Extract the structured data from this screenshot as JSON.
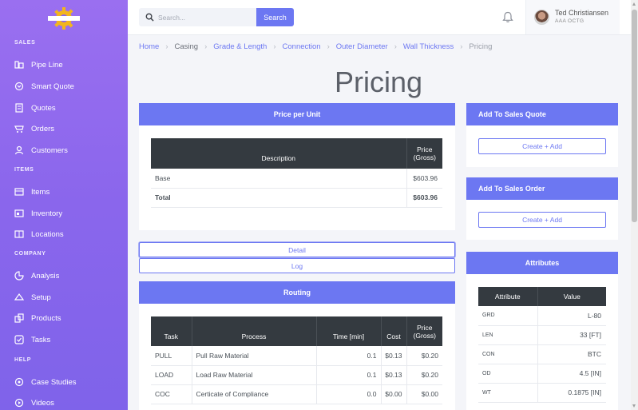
{
  "sidebar": {
    "sections": [
      {
        "title": "SALES",
        "items": [
          {
            "label": "Pipe Line",
            "icon": "pipeline-icon"
          },
          {
            "label": "Smart Quote",
            "icon": "smart-quote-icon"
          },
          {
            "label": "Quotes",
            "icon": "quotes-icon"
          },
          {
            "label": "Orders",
            "icon": "orders-icon"
          },
          {
            "label": "Customers",
            "icon": "customers-icon"
          }
        ]
      },
      {
        "title": "ITEMS",
        "items": [
          {
            "label": "Items",
            "icon": "items-icon"
          },
          {
            "label": "Inventory",
            "icon": "inventory-icon"
          },
          {
            "label": "Locations",
            "icon": "locations-icon"
          }
        ]
      },
      {
        "title": "COMPANY",
        "items": [
          {
            "label": "Analysis",
            "icon": "analysis-icon"
          },
          {
            "label": "Setup",
            "icon": "setup-icon"
          },
          {
            "label": "Products",
            "icon": "products-icon"
          },
          {
            "label": "Tasks",
            "icon": "tasks-icon"
          }
        ]
      },
      {
        "title": "HELP",
        "items": [
          {
            "label": "Case Studies",
            "icon": "case-studies-icon"
          },
          {
            "label": "Videos",
            "icon": "videos-icon"
          }
        ]
      }
    ]
  },
  "search": {
    "placeholder": "Search...",
    "button_label": "Search"
  },
  "user": {
    "name": "Ted Christiansen",
    "org": "AAA OCTG"
  },
  "breadcrumb": [
    "Home",
    "Casing",
    "Grade & Length",
    "Connection",
    "Outer Diameter",
    "Wall Thickness",
    "Pricing"
  ],
  "page_title": "Pricing",
  "price_per_unit": {
    "title": "Price per Unit",
    "columns": [
      "Description",
      "Price (Gross)"
    ],
    "rows": [
      {
        "description": "Base",
        "price": "$603.96"
      },
      {
        "description": "Total",
        "price": "$603.96"
      }
    ]
  },
  "buttons": {
    "detail": "Detail",
    "log": "Log"
  },
  "routing": {
    "title": "Routing",
    "columns": [
      "Task",
      "Process",
      "Time [min]",
      "Cost",
      "Price (Gross)"
    ],
    "rows": [
      {
        "task": "PULL",
        "process": "Pull Raw Material",
        "time": "0.1",
        "cost": "$0.13",
        "price": "$0.20"
      },
      {
        "task": "LOAD",
        "process": "Load Raw Material",
        "time": "0.1",
        "cost": "$0.13",
        "price": "$0.20"
      },
      {
        "task": "COC",
        "process": "Certicate of Compliance",
        "time": "0.0",
        "cost": "$0.00",
        "price": "$0.00"
      }
    ]
  },
  "sales_quote": {
    "title": "Add To Sales Quote",
    "button": "Create + Add"
  },
  "sales_order": {
    "title": "Add To Sales Order",
    "button": "Create + Add"
  },
  "attributes": {
    "title": "Attributes",
    "columns": [
      "Attribute",
      "Value"
    ],
    "rows": [
      {
        "name": "GRD",
        "value": "L-80"
      },
      {
        "name": "LEN",
        "value": "33 [FT]"
      },
      {
        "name": "CON",
        "value": "BTC"
      },
      {
        "name": "OD",
        "value": "4.5 [IN]"
      },
      {
        "name": "WT",
        "value": "0.1875 [IN]"
      }
    ]
  },
  "colors": {
    "accent": "#6c77f2",
    "sidebar": "#8a66ec",
    "table_header": "#343a40"
  }
}
